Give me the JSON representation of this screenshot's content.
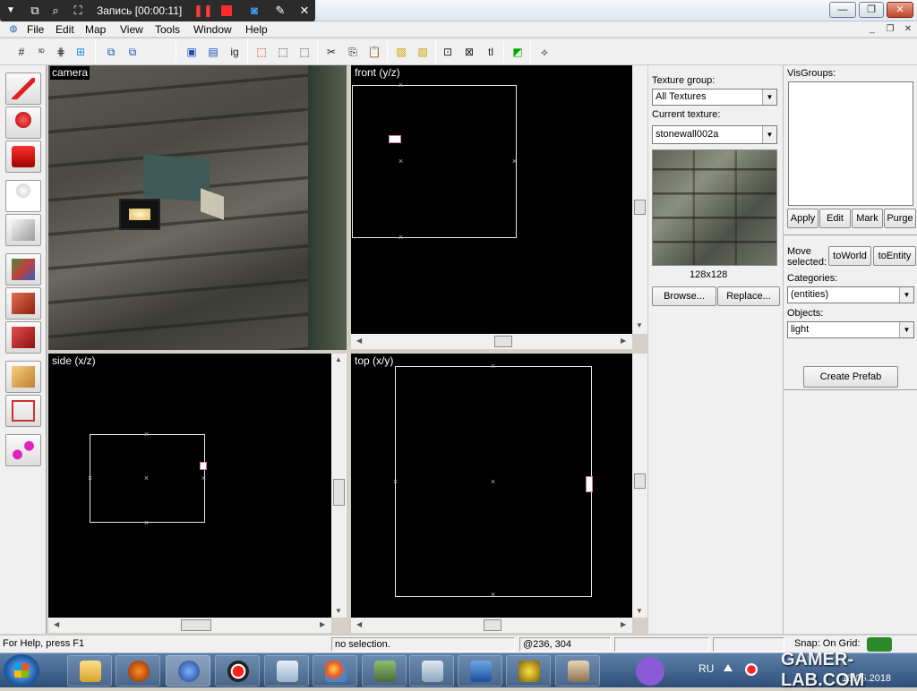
{
  "recorder": {
    "title": "Запись [00:00:11]"
  },
  "menu": {
    "items": [
      "File",
      "Edit",
      "Map",
      "View",
      "Tools",
      "Window",
      "Help"
    ]
  },
  "toolbar": {
    "ig_label": "ig",
    "tl_label": "tl"
  },
  "viewports": {
    "camera": "camera",
    "front": "front (y/z)",
    "side": "side (x/z)",
    "top": "top (x/y)"
  },
  "texture": {
    "group_label": "Texture group:",
    "group_value": "All Textures",
    "current_label": "Current texture:",
    "current_value": "stonewall002a",
    "size": "128x128",
    "browse": "Browse...",
    "replace": "Replace..."
  },
  "visgroups": {
    "label": "VisGroups:",
    "apply": "Apply",
    "edit": "Edit",
    "mark": "Mark",
    "purge": "Purge"
  },
  "move": {
    "label_line1": "Move",
    "label_line2": "selected:",
    "to_world": "toWorld",
    "to_entity": "toEntity"
  },
  "categories": {
    "label": "Categories:",
    "value": "(entities)"
  },
  "objects": {
    "label": "Objects:",
    "value": "light"
  },
  "create_prefab": "Create Prefab",
  "status": {
    "help": "For Help, press F1",
    "selection": "no selection.",
    "coords": "@236, 304",
    "snap": "Snap: On Grid:"
  },
  "taskbar": {
    "lang": "RU",
    "date": "13.05.2018"
  },
  "watermark": "GAMER-LAB.COM"
}
